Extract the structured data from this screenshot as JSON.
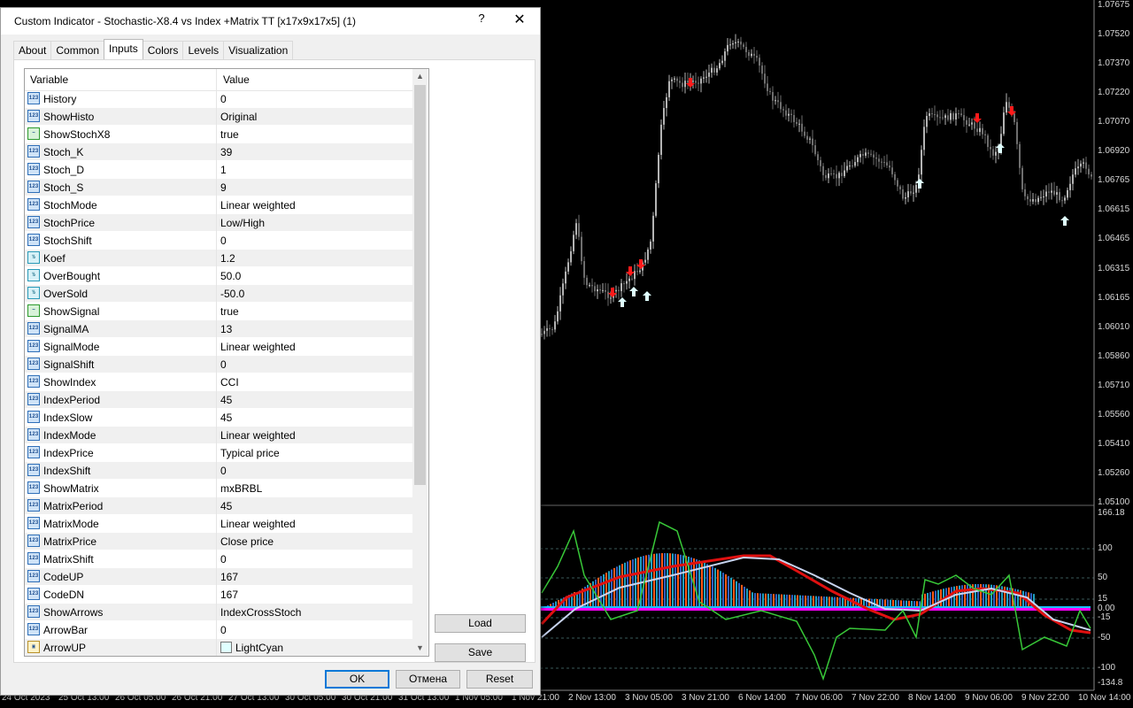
{
  "dialog": {
    "title": "Custom Indicator - Stochastic-X8.4 vs Index +Matrix TT [x17x9x17x5] (1)",
    "help": "?",
    "close": "✕",
    "tabs": [
      "About",
      "Common",
      "Inputs",
      "Colors",
      "Levels",
      "Visualization"
    ],
    "active_tab": "Inputs",
    "columns": {
      "variable": "Variable",
      "value": "Value"
    },
    "params": [
      {
        "name": "History",
        "value": "0",
        "type": "int"
      },
      {
        "name": "ShowHisto",
        "value": "Original",
        "type": "int"
      },
      {
        "name": "ShowStochX8",
        "value": "true",
        "type": "bool"
      },
      {
        "name": "Stoch_K",
        "value": "39",
        "type": "int"
      },
      {
        "name": "Stoch_D",
        "value": "1",
        "type": "int"
      },
      {
        "name": "Stoch_S",
        "value": "9",
        "type": "int"
      },
      {
        "name": "StochMode",
        "value": "Linear weighted",
        "type": "int"
      },
      {
        "name": "StochPrice",
        "value": "Low/High",
        "type": "int"
      },
      {
        "name": "StochShift",
        "value": "0",
        "type": "int"
      },
      {
        "name": "Koef",
        "value": "1.2",
        "type": "double"
      },
      {
        "name": "OverBought",
        "value": "50.0",
        "type": "double"
      },
      {
        "name": "OverSold",
        "value": "-50.0",
        "type": "double"
      },
      {
        "name": "ShowSignal",
        "value": "true",
        "type": "bool"
      },
      {
        "name": "SignalMA",
        "value": "13",
        "type": "int"
      },
      {
        "name": "SignalMode",
        "value": "Linear weighted",
        "type": "int"
      },
      {
        "name": "SignalShift",
        "value": "0",
        "type": "int"
      },
      {
        "name": "ShowIndex",
        "value": "CCI",
        "type": "int"
      },
      {
        "name": "IndexPeriod",
        "value": "45",
        "type": "int"
      },
      {
        "name": "IndexSlow",
        "value": "45",
        "type": "int"
      },
      {
        "name": "IndexMode",
        "value": "Linear weighted",
        "type": "int"
      },
      {
        "name": "IndexPrice",
        "value": "Typical price",
        "type": "int"
      },
      {
        "name": "IndexShift",
        "value": "0",
        "type": "int"
      },
      {
        "name": "ShowMatrix",
        "value": "mxBRBL",
        "type": "int"
      },
      {
        "name": "MatrixPeriod",
        "value": "45",
        "type": "int"
      },
      {
        "name": "MatrixMode",
        "value": "Linear weighted",
        "type": "int"
      },
      {
        "name": "MatrixPrice",
        "value": "Close price",
        "type": "int"
      },
      {
        "name": "MatrixShift",
        "value": "0",
        "type": "int"
      },
      {
        "name": "CodeUP",
        "value": "167",
        "type": "int"
      },
      {
        "name": "CodeDN",
        "value": "167",
        "type": "int"
      },
      {
        "name": "ShowArrows",
        "value": "IndexCrossStoch",
        "type": "int"
      },
      {
        "name": "ArrowBar",
        "value": "0",
        "type": "int"
      },
      {
        "name": "ArrowUP",
        "value": "LightCyan",
        "type": "color"
      }
    ],
    "buttons": {
      "load": "Load",
      "save": "Save",
      "ok": "OK",
      "cancel": "Отмена",
      "reset": "Reset"
    }
  },
  "chart": {
    "price_labels": [
      "1.07675",
      "1.07520",
      "1.07370",
      "1.07220",
      "1.07070",
      "1.06920",
      "1.06765",
      "1.06615",
      "1.06465",
      "1.06315",
      "1.06165",
      "1.06010",
      "1.05860",
      "1.05710",
      "1.05560",
      "1.05410",
      "1.05260",
      "1.05100"
    ],
    "indicator_labels": [
      "166.18",
      "100",
      "50",
      "15",
      "0.00",
      "-15",
      "-50",
      "-100",
      "-134.8"
    ],
    "time_labels": [
      "24 Oct 2023",
      "25 Oct 13:00",
      "26 Oct 05:00",
      "26 Oct 21:00",
      "27 Oct 13:00",
      "30 Oct 05:00",
      "30 Oct 21:00",
      "31 Oct 13:00",
      "1 Nov 05:00",
      "1 Nov 21:00",
      "2 Nov 13:00",
      "3 Nov 05:00",
      "3 Nov 21:00",
      "6 Nov 14:00",
      "7 Nov 06:00",
      "7 Nov 22:00",
      "8 Nov 14:00",
      "9 Nov 06:00",
      "9 Nov 22:00",
      "10 Nov 14:00"
    ],
    "colors": {
      "bull": "#b4b4b4",
      "bear": "#6e6e6e",
      "up_arrow": "#e0ffff",
      "down_arrow": "#ff1a1a",
      "stoch": "#e01010",
      "signal": "#c8d4f0",
      "index": "#38c838"
    }
  }
}
